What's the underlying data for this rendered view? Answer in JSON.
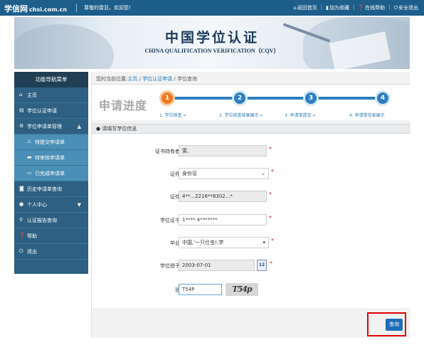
{
  "header": {
    "logo_text": "学信网",
    "logo_domain": "chsi.com.cn",
    "welcome": "尊敬的雷显，欢迎您!",
    "links": [
      {
        "label": "返回首页",
        "icon": "home-icon"
      },
      {
        "label": "加为收藏",
        "icon": "bookmark-icon"
      },
      {
        "label": "在线帮助",
        "icon": "help-icon"
      },
      {
        "label": "安全退出",
        "icon": "power-icon"
      }
    ]
  },
  "banner": {
    "title": "中国学位认证",
    "subtitle": "CHINA QUALIFICATION VERIFICATION（CQV）"
  },
  "sidebar": {
    "title": "功能导航菜单",
    "items": [
      {
        "label": "主页",
        "icon": "home-icon"
      },
      {
        "label": "学位认证申请",
        "icon": "document-icon"
      },
      {
        "label": "学位申请单管理",
        "icon": "gear-icon"
      },
      {
        "label": "待提交申请单",
        "icon": "warning-icon"
      },
      {
        "label": "待审核申请单",
        "icon": "cart-icon"
      },
      {
        "label": "已完成申请单",
        "icon": "inbox-icon"
      },
      {
        "label": "历史申请单查询",
        "icon": "camera-icon"
      },
      {
        "label": "个人中心",
        "icon": "user-icon"
      },
      {
        "label": "认证报告查询",
        "icon": "search-icon"
      },
      {
        "label": "帮助",
        "icon": "help-icon"
      },
      {
        "label": "退出",
        "icon": "power-icon"
      }
    ]
  },
  "breadcrumb": {
    "prefix": "您的当前位置:",
    "items": [
      "主页",
      "学位认证申请",
      "学位查询"
    ],
    "separator": "/"
  },
  "progress": {
    "title": "申请进度",
    "current_step": 1,
    "steps": [
      {
        "number": "1",
        "label": "1. 学位核查"
      },
      {
        "number": "2",
        "label": "2. 学位核查结果展示"
      },
      {
        "number": "3",
        "label": "3. 申请单提交"
      },
      {
        "number": "4",
        "label": "4. 申请单信息展示"
      }
    ],
    "arrow": "»"
  },
  "section": {
    "title": "请填写学位信息",
    "icon": "user-icon"
  },
  "form": {
    "fields": [
      {
        "label": "证书持有者姓名",
        "value": "雷,",
        "required_mark": "*"
      },
      {
        "label": "证件类型",
        "value": "身份证",
        "required_mark": "*"
      },
      {
        "label": "证件号码",
        "value": "4**...2216**8302...*",
        "required_mark": "*"
      },
      {
        "label": "学位证书编号",
        "value": "1****·4*******",
        "required_mark": "*"
      },
      {
        "label": "毕业学校",
        "value": "中国,'一只仕虫!;学",
        "required_mark": "*"
      },
      {
        "label": "学位授予日期",
        "value": "2003-07-01",
        "required_mark": "*"
      },
      {
        "label": "验证码",
        "value": "T54P",
        "required_mark": ""
      }
    ],
    "calendar_label": "12",
    "captcha_text": "T54p"
  },
  "actions": {
    "query_label": "查询"
  },
  "colors": {
    "topbar": "#1d5e8a",
    "sidebar": "#2d6082",
    "step_blue": "#2b7ec1",
    "step_active": "#f07a1b",
    "highlight": "#e00000"
  }
}
